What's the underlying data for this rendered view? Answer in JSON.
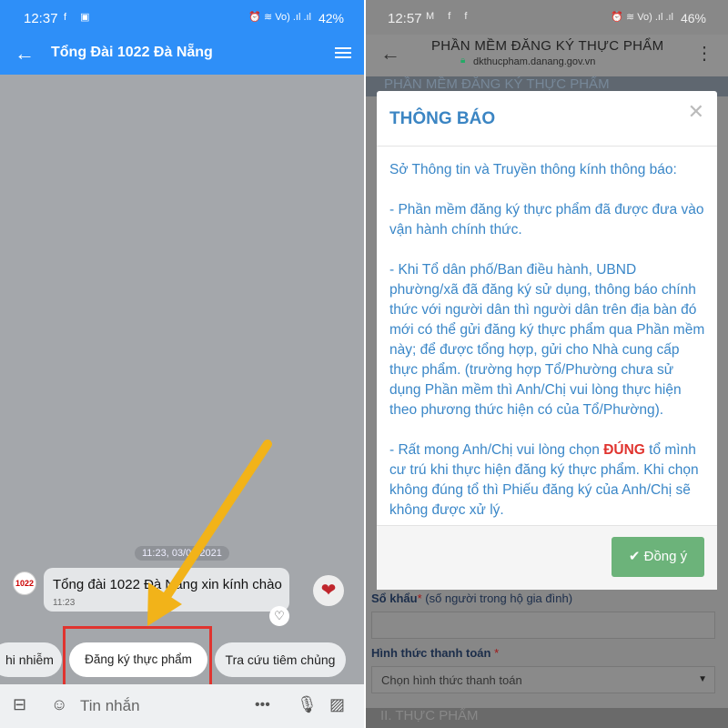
{
  "left": {
    "status": {
      "time": "12:37",
      "app_icons": "f ▣",
      "signal": "⏰ ≋ Vo) .ıl .ıl",
      "battery": "42%"
    },
    "header": {
      "title": "Tổng Đài 1022 Đà Nẵng"
    },
    "chat": {
      "date": "11:23, 03/08/2021",
      "avatar_text": "1022",
      "message": "Tổng đài 1022 Đà Nẵng xin kính chào",
      "message_time": "11:23"
    },
    "quick_replies": [
      "hi nhiễm",
      "Đăng ký thực phẩm",
      "Tra cứu tiêm chủng"
    ],
    "input": {
      "placeholder": "Tin nhắn"
    },
    "colors": {
      "header": "#2e8ff8",
      "highlight": "#e0342f",
      "arrow": "#f2b319"
    }
  },
  "right": {
    "status": {
      "time": "12:57",
      "app_icons": "M f f",
      "signal": "⏰ ≋ Vo) .ıl .ıl",
      "battery": "46%"
    },
    "header": {
      "title": "PHẦN MỀM ĐĂNG KÝ THỰC PHẨM",
      "url": "dkthucpham.danang.gov.vn"
    },
    "background_page": {
      "strip_top": "PHẦN MỀM ĐĂNG KÝ THỰC PHẨM",
      "household_label": "Sổ khẩu",
      "household_hint": "(số người trong hộ gia đình)",
      "payment_label": "Hình thức thanh toán",
      "payment_placeholder": "Chọn hình thức thanh toán",
      "strip_bottom": "II. THỰC PHẨM"
    },
    "modal": {
      "title": "THÔNG BÁO",
      "p1": "Sở Thông tin và Truyền thông kính thông báo:",
      "p2": "- Phần mềm đăng ký thực phẩm đã được đưa vào vận hành chính thức.",
      "p3": "- Khi Tổ dân phố/Ban điều hành, UBND phường/xã đã đăng ký sử dụng, thông báo chính thức với người dân thì người dân trên địa bàn đó mới có thể gửi đăng ký thực phẩm qua Phần mềm này; để được tổng hợp, gửi cho Nhà cung cấp thực phẩm. (trường hợp Tổ/Phường chưa sử dụng Phần mềm thì Anh/Chị vui lòng thực hiện theo phương thức hiện có của Tổ/Phường).",
      "p4_pre": "- Rất mong Anh/Chị vui lòng chọn ",
      "p4_em": "ĐÚNG",
      "p4_post": " tổ mình cư trú khi thực hiện đăng ký thực phẩm. Khi chọn không đúng tổ thì Phiếu đăng ký của Anh/Chị sẽ không được xử lý.",
      "ok_label": "Đồng ý"
    }
  }
}
